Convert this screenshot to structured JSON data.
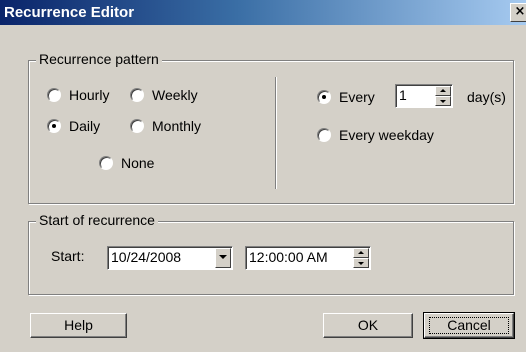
{
  "window": {
    "title": "Recurrence Editor",
    "close_glyph": "×"
  },
  "pattern": {
    "legend": "Recurrence pattern",
    "options": {
      "hourly": "Hourly",
      "weekly": "Weekly",
      "daily": "Daily",
      "monthly": "Monthly",
      "none": "None"
    },
    "selected": "daily",
    "daily": {
      "every_label": "Every",
      "every_value": "1",
      "unit_label": "day(s)",
      "weekday_label": "Every weekday",
      "selected": "every"
    }
  },
  "range": {
    "legend": "Start of recurrence",
    "start_label": "Start:",
    "start_date": "10/24/2008",
    "start_time": "12:00:00 AM"
  },
  "buttons": {
    "help": "Help",
    "ok": "OK",
    "cancel": "Cancel"
  },
  "icons": {
    "close": "close-icon",
    "radio": "radio-button-icon",
    "spin_up": "chevron-up-icon",
    "spin_down": "chevron-down-icon",
    "dropdown": "chevron-down-icon"
  },
  "colors": {
    "face": "#d4d0c8",
    "title_start": "#0a246a",
    "title_end": "#a6caf0"
  }
}
